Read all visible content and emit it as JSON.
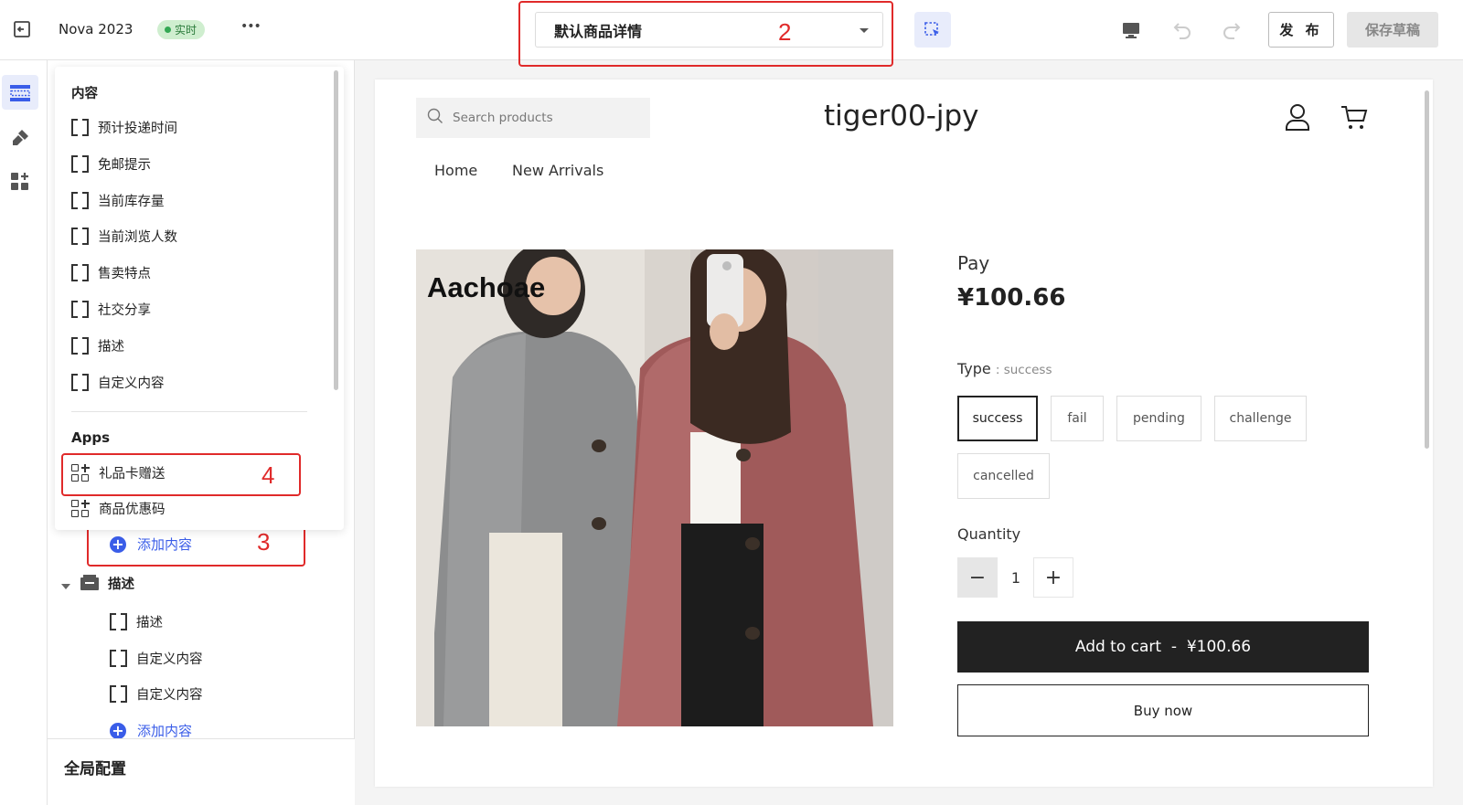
{
  "topbar": {
    "app_name": "Nova 2023",
    "status_badge": "实时",
    "more_label": "•••",
    "template_select": "默认商品详情",
    "publish_label": "发 布",
    "save_draft_label": "保存草稿"
  },
  "annotations": {
    "n2": "2",
    "n3": "3",
    "n4": "4"
  },
  "popup": {
    "content_heading": "内容",
    "content_items": [
      "预计投递时间",
      "免邮提示",
      "当前库存量",
      "当前浏览人数",
      "售卖特点",
      "社交分享",
      "描述",
      "自定义内容"
    ],
    "apps_heading": "Apps",
    "app_items": [
      "礼品卡赠送",
      "商品优惠码"
    ]
  },
  "sidebar": {
    "add_content_label": "添加内容",
    "section_title": "描述",
    "section_children": [
      "描述",
      "自定义内容",
      "自定义内容"
    ],
    "add_content_label_2": "添加内容",
    "global_config": "全局配置"
  },
  "store": {
    "search_placeholder": "Search products",
    "brand": "tiger00-jpy",
    "nav": [
      "Home",
      "New Arrivals"
    ],
    "image_text": "Aachoae",
    "pay_label": "Pay",
    "price": "¥100.66",
    "type_label": "Type",
    "type_value": "success",
    "type_options": [
      "success",
      "fail",
      "pending",
      "challenge",
      "cancelled"
    ],
    "quantity_label": "Quantity",
    "quantity": "1",
    "minus": "−",
    "plus": "+",
    "add_to_cart": "Add to cart  -  ¥100.66",
    "buy_now": "Buy now"
  },
  "colors": {
    "accent": "#3a5de8",
    "annotation_red": "#e02a2a",
    "cart_button": "#222222",
    "status_green": "#33a853"
  }
}
